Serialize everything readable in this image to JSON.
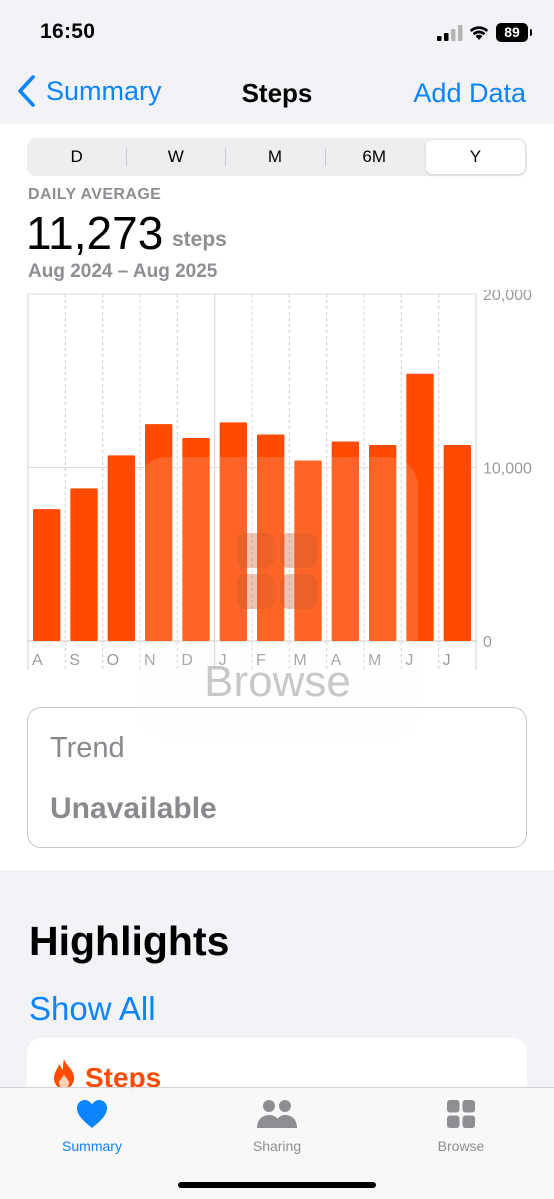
{
  "status_bar": {
    "time": "16:50",
    "battery": "89"
  },
  "nav": {
    "back_label": "Summary",
    "title": "Steps",
    "action_label": "Add Data"
  },
  "segments": [
    "D",
    "W",
    "M",
    "6M",
    "Y"
  ],
  "active_segment": "Y",
  "summary": {
    "label": "DAILY AVERAGE",
    "value": "11,273",
    "unit": "steps",
    "date_range": "Aug 2024 – Aug 2025"
  },
  "chart_data": {
    "type": "bar",
    "categories": [
      "A",
      "S",
      "O",
      "N",
      "D",
      "J",
      "F",
      "M",
      "A",
      "M",
      "J",
      "J"
    ],
    "values": [
      7600,
      8800,
      10700,
      12500,
      11700,
      12600,
      11900,
      10400,
      11500,
      11300,
      15400,
      11300
    ],
    "y_ticks": [
      "20,000",
      "10,000",
      "0"
    ],
    "ylim": [
      0,
      20000
    ],
    "bar_color": "#ff4a00",
    "grid": true
  },
  "overlay": {
    "label": "Browse"
  },
  "trend": {
    "title": "Trend",
    "status": "Unavailable"
  },
  "highlights": {
    "title": "Highlights",
    "show_all": "Show All",
    "card_title": "Steps"
  },
  "tabs": [
    {
      "label": "Summary",
      "icon": "heart-icon",
      "active": true
    },
    {
      "label": "Sharing",
      "icon": "people-icon",
      "active": false
    },
    {
      "label": "Browse",
      "icon": "grid-icon",
      "active": false
    }
  ],
  "colors": {
    "accent": "#0a84ff",
    "bars": "#ff4a00",
    "secondary_text": "#8e8e93"
  }
}
